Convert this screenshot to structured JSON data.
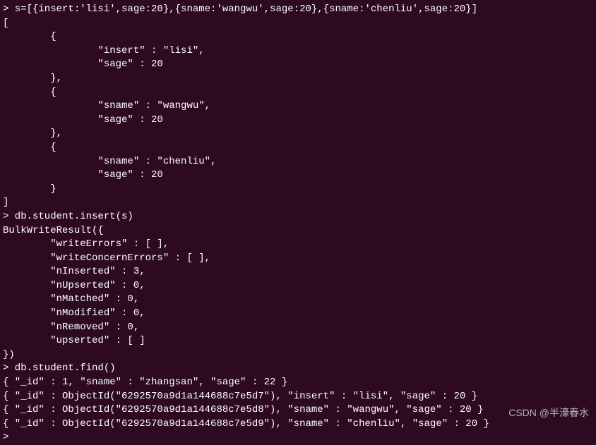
{
  "terminal": {
    "lines": [
      "> s=[{insert:'lisi',sage:20},{sname:'wangwu',sage:20},{sname:'chenliu',sage:20}]",
      "[",
      "        {",
      "                \"insert\" : \"lisi\",",
      "                \"sage\" : 20",
      "        },",
      "        {",
      "                \"sname\" : \"wangwu\",",
      "                \"sage\" : 20",
      "        },",
      "        {",
      "                \"sname\" : \"chenliu\",",
      "                \"sage\" : 20",
      "        }",
      "]",
      "> db.student.insert(s)",
      "BulkWriteResult({",
      "        \"writeErrors\" : [ ],",
      "        \"writeConcernErrors\" : [ ],",
      "        \"nInserted\" : 3,",
      "        \"nUpserted\" : 0,",
      "        \"nMatched\" : 0,",
      "        \"nModified\" : 0,",
      "        \"nRemoved\" : 0,",
      "        \"upserted\" : [ ]",
      "})",
      "> db.student.find()",
      "{ \"_id\" : 1, \"sname\" : \"zhangsan\", \"sage\" : 22 }",
      "{ \"_id\" : ObjectId(\"6292570a9d1a144688c7e5d7\"), \"insert\" : \"lisi\", \"sage\" : 20 }",
      "{ \"_id\" : ObjectId(\"6292570a9d1a144688c7e5d8\"), \"sname\" : \"wangwu\", \"sage\" : 20 }",
      "{ \"_id\" : ObjectId(\"6292570a9d1a144688c7e5d9\"), \"sname\" : \"chenliu\", \"sage\" : 20 }",
      "> "
    ],
    "watermark": "CSDN @半濠春水"
  }
}
